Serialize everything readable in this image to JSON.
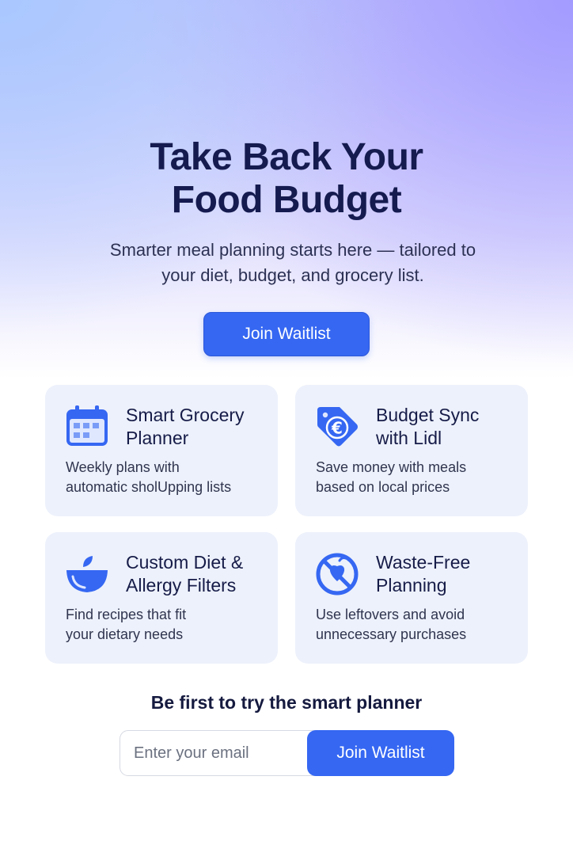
{
  "hero": {
    "title_line1": "Take Back Your",
    "title_line2": "Food Budget",
    "subtitle_line1": "Smarter meal planning starts here — tailored to",
    "subtitle_line2": "your diet, budget, and grocery list.",
    "cta_label": "Join Waitlist"
  },
  "features": [
    {
      "icon": "calendar-icon",
      "title_line1": "Smart Grocery",
      "title_line2": "Planner",
      "desc_line1": "Weekly plans with",
      "desc_line2": "automatic sholUpping lists"
    },
    {
      "icon": "euro-price-tag-icon",
      "title_line1": "Budget Sync",
      "title_line2": "with Lidl",
      "desc_line1": "Save money with meals",
      "desc_line2": "based on local prices"
    },
    {
      "icon": "apple-bowl-icon",
      "title_line1": "Custom Diet &",
      "title_line2": "Allergy Filters",
      "desc_line1": "Find recipes that fit",
      "desc_line2": "your dietary needs"
    },
    {
      "icon": "no-waste-icon",
      "title_line1": "Waste-Free",
      "title_line2": "Planning",
      "desc_line1": "Use leftovers and avoid",
      "desc_line2": "unnecessary purchases"
    }
  ],
  "signup": {
    "heading": "Be first to try the smart planner",
    "email_placeholder": "Enter your email",
    "button_label": "Join Waitlist"
  },
  "colors": {
    "accent": "#3567f2",
    "card_bg": "#edf1fb",
    "heading": "#151b4f"
  }
}
